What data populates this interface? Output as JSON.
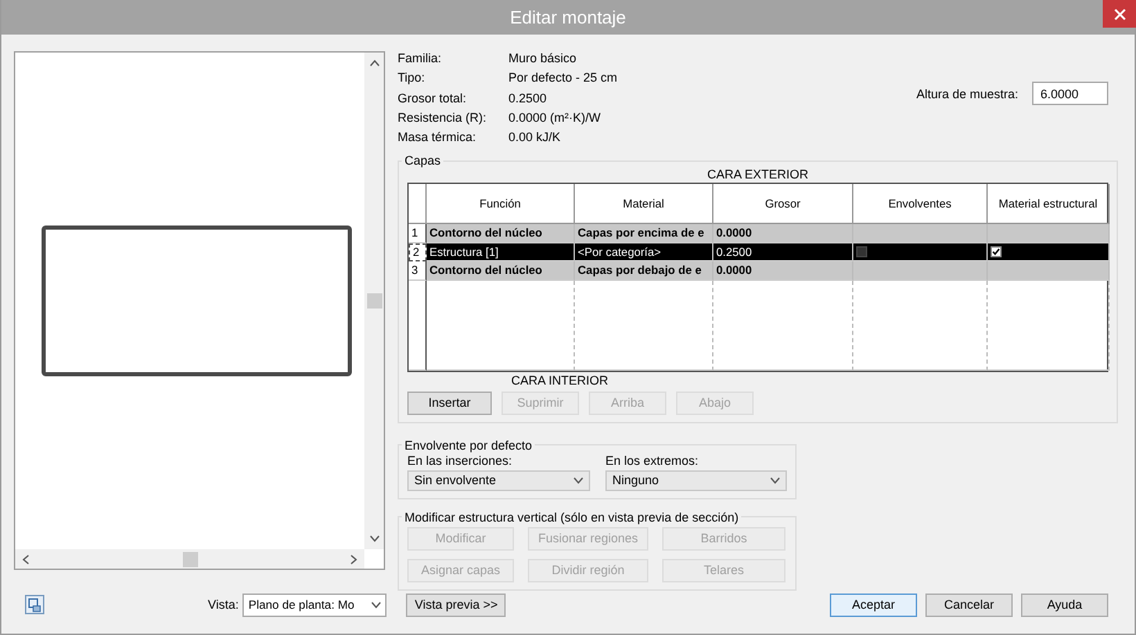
{
  "window": {
    "title": "Editar montaje"
  },
  "properties": [
    {
      "label": "Familia:",
      "value": "Muro básico"
    },
    {
      "label": "Tipo:",
      "value": "Por defecto - 25 cm"
    },
    {
      "label": "Grosor total:",
      "value": "0.2500"
    },
    {
      "label": "Resistencia (R):",
      "value": "0.0000 (m²·K)/W"
    },
    {
      "label": "Masa térmica:",
      "value": "0.00 kJ/K"
    }
  ],
  "sample_height": {
    "label": "Altura de muestra:",
    "value": "6.0000"
  },
  "layers": {
    "group_label": "Capas",
    "top_caption": "CARA EXTERIOR",
    "bottom_caption": "CARA INTERIOR",
    "columns": [
      "Función",
      "Material",
      "Grosor",
      "Envolventes",
      "Material estructural"
    ],
    "rows": [
      {
        "number": "1",
        "function": "Contorno del núcleo",
        "material": "Capas por encima de e",
        "thickness": "0.0000",
        "kind": "boundary",
        "selected": false
      },
      {
        "number": "2",
        "function": "Estructura [1]",
        "material": "<Por categoría>",
        "thickness": "0.2500",
        "kind": "layer",
        "selected": true,
        "wraps": false,
        "structural_material": true
      },
      {
        "number": "3",
        "function": "Contorno del núcleo",
        "material": "Capas por debajo de e",
        "thickness": "0.0000",
        "kind": "boundary",
        "selected": false
      }
    ],
    "buttons": [
      {
        "label": "Insertar",
        "disabled": false
      },
      {
        "label": "Suprimir",
        "disabled": true
      },
      {
        "label": "Arriba",
        "disabled": true
      },
      {
        "label": "Abajo",
        "disabled": true
      }
    ]
  },
  "default_wrapping": {
    "group_label": "Envolvente por defecto",
    "at_inserts": {
      "label": "En las inserciones:",
      "value": "Sin envolvente"
    },
    "at_ends": {
      "label": "En los extremos:",
      "value": "Ninguno"
    }
  },
  "vertical_structure": {
    "group_label": "Modificar estructura vertical (sólo en vista previa de sección)",
    "buttons": [
      {
        "label": "Modificar",
        "disabled": true
      },
      {
        "label": "Fusionar regiones",
        "disabled": true
      },
      {
        "label": "Barridos",
        "disabled": true
      },
      {
        "label": "Asignar capas",
        "disabled": true
      },
      {
        "label": "Dividir región",
        "disabled": true
      },
      {
        "label": "Telares",
        "disabled": true
      }
    ]
  },
  "footer": {
    "view_label": "Vista:",
    "view_value": "Plano de planta: Mo",
    "preview_button": "Vista previa >>",
    "buttons": [
      {
        "label": "Aceptar",
        "default": true
      },
      {
        "label": "Cancelar",
        "default": false
      },
      {
        "label": "Ayuda",
        "default": false
      }
    ]
  }
}
